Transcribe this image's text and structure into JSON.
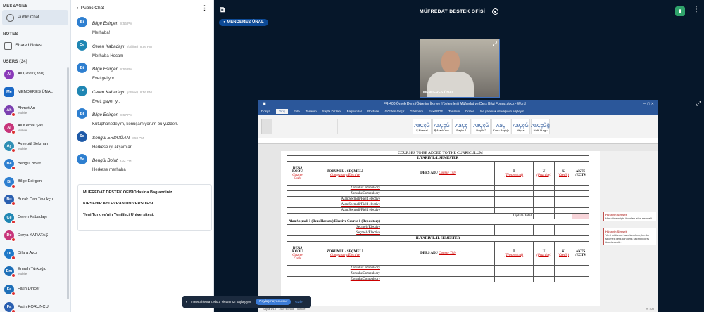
{
  "sidebar": {
    "messages_title": "MESSAGES",
    "public_chat": "Public Chat",
    "notes_title": "NOTES",
    "shared_notes": "Shared Notes",
    "users_title": "USERS (34)",
    "users": [
      {
        "initials": "Al",
        "name": "Ali Çevik (You)",
        "sub": "",
        "color": "#8a3ab9",
        "sq": false
      },
      {
        "initials": "Me",
        "name": "MENDERES ÜNAL",
        "sub": "",
        "color": "#1b69c6",
        "sq": true
      },
      {
        "initials": "Ah",
        "name": "Ahmet Arı",
        "sub": "Mobile",
        "color": "#7b3fb0",
        "sq": false
      },
      {
        "initials": "Al",
        "name": "Ali Kemal Şaş",
        "sub": "Mobile",
        "color": "#c7347a",
        "sq": false
      },
      {
        "initials": "Ay",
        "name": "Ayşegül Sekman",
        "sub": "Mobile",
        "color": "#2f8fb5",
        "sq": false
      },
      {
        "initials": "Be",
        "name": "Bengül Bolat",
        "sub": "",
        "color": "#2e7fd0",
        "sq": false
      },
      {
        "initials": "Bi",
        "name": "Bilge Esirgen",
        "sub": "",
        "color": "#2e7fd0",
        "sq": false
      },
      {
        "initials": "Bu",
        "name": "Burak Can Tavukçu",
        "sub": "",
        "color": "#2a5fb0",
        "sq": false
      },
      {
        "initials": "Ce",
        "name": "Ceren Kabadayı",
        "sub": "",
        "color": "#1f86b3",
        "sq": false
      },
      {
        "initials": "De",
        "name": "Derya KARATAŞ",
        "sub": "",
        "color": "#c7347a",
        "sq": false
      },
      {
        "initials": "Di",
        "name": "Dilara Avcı",
        "sub": "",
        "color": "#1e78c8",
        "sq": false
      },
      {
        "initials": "Em",
        "name": "Emrah Türkoğlu",
        "sub": "Mobile",
        "color": "#1e6fb8",
        "sq": false
      },
      {
        "initials": "Fa",
        "name": "Fatih Dinçer",
        "sub": "",
        "color": "#1e6fb8",
        "sq": false
      },
      {
        "initials": "Fa",
        "name": "Fatih KORUNCU",
        "sub": "",
        "color": "#2a5fb0",
        "sq": false
      }
    ]
  },
  "chat": {
    "title": "Public Chat",
    "messages": [
      {
        "initials": "Bi",
        "name": "Bilge Esirgen",
        "offline": "",
        "time": "8:56 PM",
        "text": "Merhaba!",
        "color": "#2e7fd0"
      },
      {
        "initials": "Ce",
        "name": "Ceren Kabadayı",
        "offline": "(offline)",
        "time": "8:56 PM",
        "text": "Merhaba Hocam",
        "color": "#1f86b3"
      },
      {
        "initials": "Bi",
        "name": "Bilge Esirgen",
        "offline": "",
        "time": "8:56 PM",
        "text": "Evet geliyor",
        "color": "#2e7fd0"
      },
      {
        "initials": "Ce",
        "name": "Ceren Kabadayı",
        "offline": "(offline)",
        "time": "8:56 PM",
        "text": "Evet, gayet iyi.",
        "color": "#1f86b3"
      },
      {
        "initials": "Bi",
        "name": "Bilge Esirgen",
        "offline": "",
        "time": "8:57 PM",
        "text": "Kütüphanedeyim, konuşamıyorum bu yüzden.",
        "color": "#2e7fd0"
      },
      {
        "initials": "So",
        "name": "Songül ERDOĞAN",
        "offline": "",
        "time": "8:58 PM",
        "text": "Herkese iyi akşamlar.",
        "color": "#1e5aa8"
      },
      {
        "initials": "Be",
        "name": "Bengül Bolat",
        "offline": "",
        "time": "9:02 PM",
        "text": "Herkese merhaba",
        "color": "#2e7fd0"
      }
    ],
    "welcome": {
      "line1a": "MÜFREDAT DESTEK OFİSİ",
      "line1b": "Odasina Baglandiniz.",
      "line2": "KIRSEHIR AHI EVRAN UNIVERSITESI.",
      "line3": "Yeni Turkiye'nin Yenilikci Universitesi."
    }
  },
  "main": {
    "room_title": "MÜFREDAT DESTEK OFİSİ",
    "presenter": "MENDERES ÜNAL",
    "camera_label": "MENDERES ÜNAL",
    "share_text": "meet.ahievran.edu.tr ekranınızı paylaşıyor.",
    "share_button": "Paylaşmayı durdur",
    "share_hide": "Gizle"
  },
  "word": {
    "title": "FR-400 Örnek Ders (Öğretim İlke ve Yöntemleri) Müfredat ve Ders Bilgi Formu.docx - Word",
    "tabs": [
      "Dosya",
      "Giriş",
      "Ekle",
      "Tasarım",
      "Sayfa Düzeni",
      "Başvurular",
      "Postalar",
      "Gözden Geçir",
      "Görünüm",
      "Foxit PDF",
      "Tasarım",
      "Düzen"
    ],
    "tellme": "Ne yapmak istediğinizi söyleyin...",
    "styles": [
      {
        "sample": "AaÇçĞ",
        "name": "¶ Normal"
      },
      {
        "sample": "AaÇçĞ",
        "name": "¶ Aralık Yok"
      },
      {
        "sample": "AaÇç",
        "name": "Başlık 1"
      },
      {
        "sample": "AaÇçĞ",
        "name": "Başlık 2"
      },
      {
        "sample": "AaÇ",
        "name": "Konu Başlığı"
      },
      {
        "sample": "AaÇçĞ",
        "name": "Altyazı"
      },
      {
        "sample": "AaÇçĞğ",
        "name": "Hafif Vurgu"
      }
    ],
    "doc_heading": "COURSES TO BE ADDED TO THE CURRICULUM",
    "sem1": "I. YARIYIL/I. SEMESTER",
    "sem2": "II. YARIYIL/II. SEMESTER",
    "col_code": "DERS KODU",
    "col_code_en": "Course Code",
    "col_type": "ZORUNLU / SEÇMELİ",
    "col_type_en": "Compulsory/Elective",
    "col_name": "DERS ADI/",
    "col_name_en": "Course Title",
    "col_t": "T",
    "col_t_en": "(Theoretical)",
    "col_u": "U",
    "col_u_en": "(Practice)",
    "col_k": "K",
    "col_k_en": "(Credit)",
    "col_akts": "AKTS /ECTS",
    "rows": [
      "Zorunlu/Compulsory",
      "Zorunlu/Compulsory",
      "Alan Seçmeli/Field elective",
      "Alan Seçmeli/Field elective",
      "Alan Seçmeli/Field elective"
    ],
    "total": "Toplam/Total",
    "elective_pool": "Alan Seçmeli I (Ders Havuzu) Elective Course 1 (Repository)",
    "pool_rows": [
      "Seçmeli/Elective",
      "Seçmeli/Elective"
    ],
    "rows2": [
      "Zorunlu/Compulsory",
      "Zorunlu/Compulsory",
      "Zorunlu/Compulsory"
    ],
    "comment1_name": "Hüseyin Şimşek",
    "comment1_text": "Her dönem için önerilen alan seçmeli.",
    "comment2_name": "Hüseyin Şimşek",
    "comment2_text": "Yeni müfredat hazırlanırken, her bir seçmeli ders için ders seçmeli ders önerilecektir.",
    "status_page": "Sayfa 1/10",
    "status_words": "1410 sözcük",
    "status_lang": "Türkçe",
    "zoom": "% 100"
  }
}
